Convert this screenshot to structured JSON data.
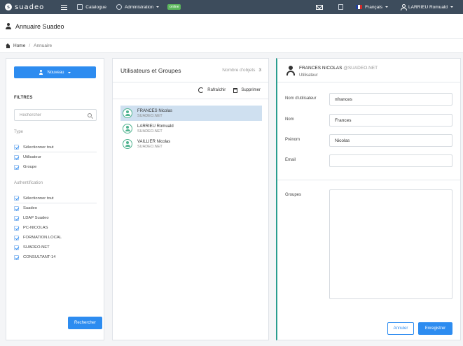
{
  "topbar": {
    "brand": "suadeo",
    "nav": [
      {
        "label": "Catalogue",
        "icon": "catalogue-icon"
      },
      {
        "label": "Administration",
        "icon": "administration-icon"
      }
    ],
    "status_badge": "online",
    "language": "Français",
    "user": "LARRIEU Romuald",
    "colors": {
      "bar": "#3d4c5c",
      "badge": "#5cb85c"
    }
  },
  "page": {
    "title": "Annuaire Suadeo",
    "breadcrumb": {
      "home": "Home",
      "separator": "/",
      "current": "Annuaire"
    }
  },
  "filters": {
    "new_button": "Nouveau",
    "title": "FILTRES",
    "search_placeholder": "Rechercher",
    "type_label": "Type",
    "type_items": [
      "Sélectionner tout",
      "Utilisateur",
      "Groupe"
    ],
    "auth_label": "Authentification",
    "auth_items": [
      "Sélectionner tout",
      "Suadeo",
      "LDAP Suadeo",
      "PC-NICOLAS",
      "FORMATION.LOCAL",
      "SUADEO.NET",
      "CONSULTANT-14"
    ],
    "search_button": "Rechercher"
  },
  "list": {
    "title": "Utilisateurs et Groupes",
    "count_label": "Nombre d'objets",
    "count": "3",
    "refresh": "Rafraîchir",
    "delete": "Supprimer",
    "items": [
      {
        "name": "FRANCES Nicolas",
        "domain": "SUADEO.NET",
        "selected": true
      },
      {
        "name": "LARRIEU Romuald",
        "domain": "SUADEO.NET",
        "selected": false
      },
      {
        "name": "VAILLIER Nicolas",
        "domain": "SUADEO.NET",
        "selected": false
      }
    ]
  },
  "detail": {
    "header_name": "FRANCES NICOLAS",
    "header_domain": "@SUADEO.NET",
    "header_type": "Utilisateur",
    "fields": {
      "username": {
        "label": "Nom d'utilisateur",
        "value": "nfrances"
      },
      "lastname": {
        "label": "Nom",
        "value": "Frances"
      },
      "firstname": {
        "label": "Prénom",
        "value": "Nicolas"
      },
      "email": {
        "label": "Email",
        "value": ""
      }
    },
    "groups_label": "Groupes",
    "cancel_button": "Annuler",
    "save_button": "Enregistrer",
    "accent": "#2a9d8f"
  }
}
